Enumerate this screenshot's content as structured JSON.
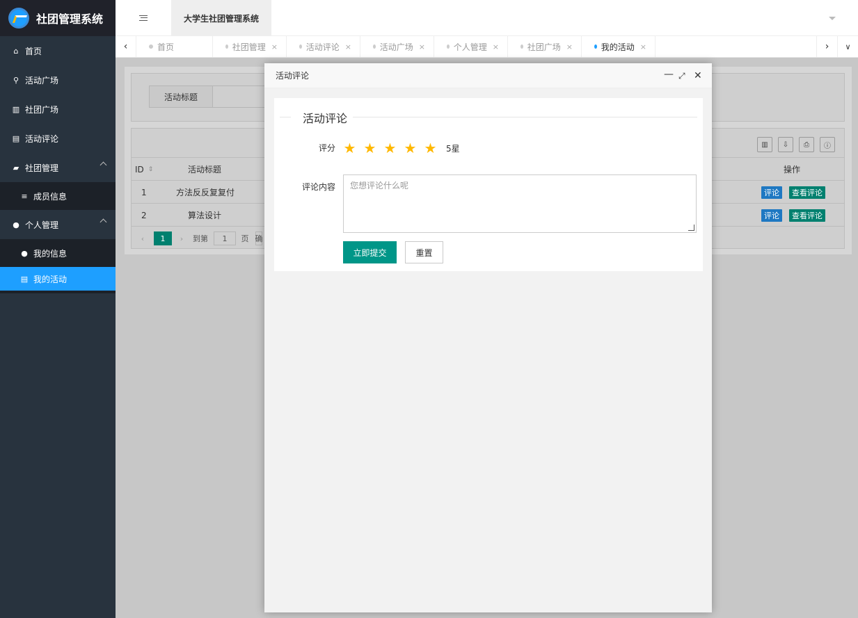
{
  "app": {
    "title": "社团管理系统",
    "header_title": "大学生社团管理系统"
  },
  "sidebar": {
    "items": [
      {
        "label": "首页",
        "icon": "home-icon"
      },
      {
        "label": "活动广场",
        "icon": "bicycle-icon"
      },
      {
        "label": "社团广场",
        "icon": "bank-icon"
      },
      {
        "label": "活动评论",
        "icon": "list-icon"
      },
      {
        "label": "社团管理",
        "icon": "book-icon"
      },
      {
        "label": "成员信息",
        "icon": "menu-icon"
      },
      {
        "label": "个人管理",
        "icon": "user-icon"
      },
      {
        "label": "我的信息",
        "icon": "user-icon"
      },
      {
        "label": "我的活动",
        "icon": "list-icon"
      }
    ]
  },
  "tabs": [
    {
      "label": "首页"
    },
    {
      "label": "社团管理"
    },
    {
      "label": "活动评论"
    },
    {
      "label": "活动广场"
    },
    {
      "label": "个人管理"
    },
    {
      "label": "社团广场"
    },
    {
      "label": "我的活动"
    }
  ],
  "search": {
    "label": "活动标题"
  },
  "table": {
    "headers": {
      "id": "ID",
      "title": "活动标题",
      "ops": "操作"
    },
    "rows": [
      {
        "id": "1",
        "title": "方法反反复复付"
      },
      {
        "id": "2",
        "title": "算法设计"
      }
    ],
    "btn_comment": "评论",
    "btn_view": "查看评论",
    "pager": {
      "current": "1",
      "goto": "到第",
      "page_input": "1",
      "page_unit": "页",
      "confirm": "确"
    }
  },
  "modal": {
    "title": "活动评论",
    "legend": "活动评论",
    "rating_label": "评分",
    "rating_value": 5,
    "rating_text": "5星",
    "content_label": "评论内容",
    "content_placeholder": "您想评论什么呢",
    "submit": "立即提交",
    "reset": "重置"
  },
  "colors": {
    "primary": "#009688",
    "blue": "#1e9fff",
    "star": "#ffb800",
    "sidebar": "#28333e"
  }
}
